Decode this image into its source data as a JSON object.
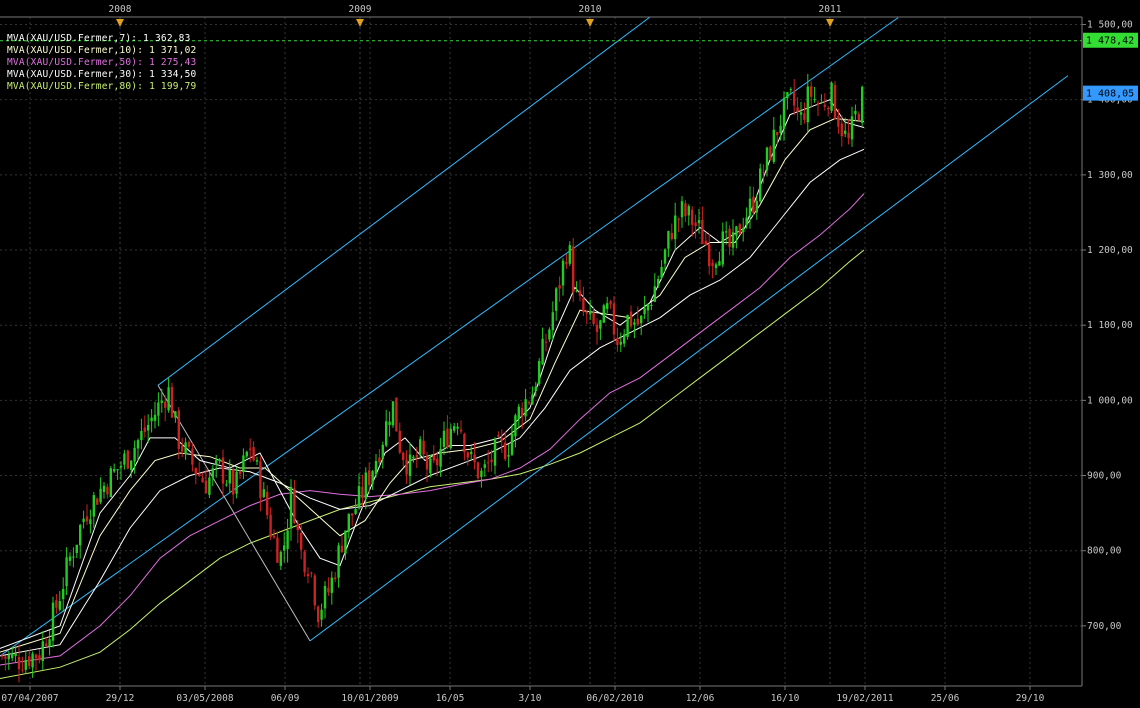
{
  "chart_data": {
    "type": "candlestick",
    "instrument": "XAU/USD",
    "ylim": [
      620,
      1510
    ],
    "y_ticks": [
      "1 500,00",
      "1 400,00",
      "1 300,00",
      "1 200,00",
      "1 100,00",
      "1 000,00",
      "900,00",
      "800,00",
      "700,00"
    ],
    "x_ticks": [
      "07/04/2007",
      "29/12",
      "03/05/2008",
      "06/09",
      "10/01/2009",
      "16/05",
      "3/10",
      "06/02/2010",
      "12/06",
      "16/10",
      "19/02/2011",
      "25/06",
      "29/10"
    ],
    "years": [
      "2008",
      "2009",
      "2010",
      "2011"
    ],
    "legend": [
      {
        "label": "MVA(XAU/USD.Fermer,7): 1 362,83",
        "color": "#ffffff"
      },
      {
        "label": "MVA(XAU/USD.Fermer,10): 1 371,02",
        "color": "#ffffd0"
      },
      {
        "label": "MVA(XAU/USD.Fermer,50): 1 275,43",
        "color": "#e070e0"
      },
      {
        "label": "MVA(XAU/USD.Fermer,30): 1 334,50",
        "color": "#ffffff"
      },
      {
        "label": "MVA(XAU/USD.Fermer,80): 1 199,79",
        "color": "#c8f070"
      }
    ],
    "reference_line": {
      "value": 1478.42,
      "label": "1 478,42",
      "color": "#33dd33"
    },
    "last_price": {
      "value": 1408.05,
      "label": "1 408,05",
      "color": "#3399ff"
    },
    "colors": {
      "up": "#22cc22",
      "down": "#cc2222",
      "channel": "#33bbff",
      "grid": "#333333"
    },
    "price_path": [
      [
        0,
        660
      ],
      [
        20,
        655
      ],
      [
        40,
        665
      ],
      [
        55,
        720
      ],
      [
        70,
        790
      ],
      [
        85,
        850
      ],
      [
        100,
        880
      ],
      [
        115,
        905
      ],
      [
        130,
        930
      ],
      [
        145,
        960
      ],
      [
        158,
        990
      ],
      [
        168,
        1015
      ],
      [
        178,
        950
      ],
      [
        190,
        920
      ],
      [
        205,
        890
      ],
      [
        220,
        910
      ],
      [
        235,
        880
      ],
      [
        250,
        940
      ],
      [
        262,
        880
      ],
      [
        272,
        820
      ],
      [
        282,
        790
      ],
      [
        292,
        880
      ],
      [
        300,
        800
      ],
      [
        310,
        780
      ],
      [
        318,
        720
      ],
      [
        330,
        750
      ],
      [
        345,
        830
      ],
      [
        360,
        870
      ],
      [
        375,
        920
      ],
      [
        385,
        960
      ],
      [
        392,
        1000
      ],
      [
        400,
        940
      ],
      [
        410,
        910
      ],
      [
        420,
        930
      ],
      [
        432,
        900
      ],
      [
        445,
        950
      ],
      [
        458,
        980
      ],
      [
        470,
        920
      ],
      [
        482,
        900
      ],
      [
        495,
        930
      ],
      [
        508,
        940
      ],
      [
        520,
        990
      ],
      [
        532,
        1010
      ],
      [
        540,
        1050
      ],
      [
        550,
        1100
      ],
      [
        560,
        1160
      ],
      [
        568,
        1210
      ],
      [
        575,
        1140
      ],
      [
        585,
        1110
      ],
      [
        598,
        1090
      ],
      [
        608,
        1120
      ],
      [
        618,
        1080
      ],
      [
        628,
        1110
      ],
      [
        640,
        1100
      ],
      [
        652,
        1140
      ],
      [
        662,
        1180
      ],
      [
        672,
        1230
      ],
      [
        682,
        1250
      ],
      [
        692,
        1240
      ],
      [
        702,
        1220
      ],
      [
        712,
        1190
      ],
      [
        722,
        1210
      ],
      [
        732,
        1200
      ],
      [
        742,
        1240
      ],
      [
        752,
        1260
      ],
      [
        762,
        1300
      ],
      [
        772,
        1340
      ],
      [
        782,
        1380
      ],
      [
        792,
        1400
      ],
      [
        800,
        1370
      ],
      [
        810,
        1410
      ],
      [
        820,
        1390
      ],
      [
        830,
        1410
      ],
      [
        840,
        1370
      ],
      [
        848,
        1340
      ],
      [
        856,
        1380
      ],
      [
        864,
        1408
      ]
    ],
    "ma7": [
      [
        0,
        670
      ],
      [
        60,
        700
      ],
      [
        100,
        850
      ],
      [
        130,
        900
      ],
      [
        150,
        950
      ],
      [
        175,
        950
      ],
      [
        200,
        920
      ],
      [
        230,
        910
      ],
      [
        260,
        930
      ],
      [
        280,
        880
      ],
      [
        300,
        830
      ],
      [
        320,
        790
      ],
      [
        340,
        780
      ],
      [
        360,
        850
      ],
      [
        385,
        930
      ],
      [
        405,
        950
      ],
      [
        425,
        920
      ],
      [
        450,
        940
      ],
      [
        470,
        940
      ],
      [
        500,
        950
      ],
      [
        530,
        990
      ],
      [
        555,
        1090
      ],
      [
        575,
        1150
      ],
      [
        595,
        1120
      ],
      [
        620,
        1100
      ],
      [
        650,
        1130
      ],
      [
        675,
        1200
      ],
      [
        700,
        1230
      ],
      [
        720,
        1210
      ],
      [
        745,
        1230
      ],
      [
        770,
        1320
      ],
      [
        790,
        1380
      ],
      [
        810,
        1390
      ],
      [
        830,
        1400
      ],
      [
        845,
        1370
      ],
      [
        864,
        1363
      ]
    ],
    "ma10": [
      [
        0,
        665
      ],
      [
        60,
        690
      ],
      [
        100,
        820
      ],
      [
        130,
        880
      ],
      [
        155,
        920
      ],
      [
        180,
        930
      ],
      [
        210,
        925
      ],
      [
        240,
        910
      ],
      [
        265,
        910
      ],
      [
        290,
        880
      ],
      [
        315,
        850
      ],
      [
        340,
        820
      ],
      [
        365,
        840
      ],
      [
        390,
        890
      ],
      [
        410,
        920
      ],
      [
        440,
        930
      ],
      [
        470,
        935
      ],
      [
        500,
        945
      ],
      [
        530,
        975
      ],
      [
        555,
        1050
      ],
      [
        580,
        1120
      ],
      [
        605,
        1115
      ],
      [
        630,
        1110
      ],
      [
        660,
        1140
      ],
      [
        685,
        1190
      ],
      [
        710,
        1210
      ],
      [
        735,
        1210
      ],
      [
        760,
        1260
      ],
      [
        785,
        1320
      ],
      [
        810,
        1360
      ],
      [
        835,
        1375
      ],
      [
        864,
        1371
      ]
    ],
    "ma30": [
      [
        0,
        660
      ],
      [
        60,
        675
      ],
      [
        100,
        760
      ],
      [
        130,
        830
      ],
      [
        160,
        880
      ],
      [
        190,
        900
      ],
      [
        220,
        910
      ],
      [
        250,
        905
      ],
      [
        280,
        890
      ],
      [
        310,
        870
      ],
      [
        340,
        855
      ],
      [
        370,
        860
      ],
      [
        400,
        880
      ],
      [
        430,
        900
      ],
      [
        460,
        915
      ],
      [
        490,
        930
      ],
      [
        520,
        950
      ],
      [
        545,
        990
      ],
      [
        570,
        1040
      ],
      [
        600,
        1070
      ],
      [
        630,
        1090
      ],
      [
        660,
        1110
      ],
      [
        690,
        1140
      ],
      [
        720,
        1160
      ],
      [
        750,
        1190
      ],
      [
        780,
        1240
      ],
      [
        810,
        1290
      ],
      [
        840,
        1320
      ],
      [
        864,
        1334
      ]
    ],
    "ma50": [
      [
        0,
        648
      ],
      [
        60,
        660
      ],
      [
        100,
        700
      ],
      [
        130,
        740
      ],
      [
        160,
        790
      ],
      [
        190,
        820
      ],
      [
        220,
        840
      ],
      [
        250,
        860
      ],
      [
        280,
        875
      ],
      [
        310,
        880
      ],
      [
        340,
        875
      ],
      [
        370,
        872
      ],
      [
        400,
        875
      ],
      [
        430,
        880
      ],
      [
        460,
        888
      ],
      [
        490,
        895
      ],
      [
        520,
        910
      ],
      [
        550,
        935
      ],
      [
        580,
        975
      ],
      [
        610,
        1010
      ],
      [
        640,
        1030
      ],
      [
        670,
        1060
      ],
      [
        700,
        1090
      ],
      [
        730,
        1120
      ],
      [
        760,
        1150
      ],
      [
        790,
        1190
      ],
      [
        820,
        1220
      ],
      [
        850,
        1255
      ],
      [
        864,
        1275
      ]
    ],
    "ma80": [
      [
        0,
        630
      ],
      [
        60,
        645
      ],
      [
        100,
        665
      ],
      [
        130,
        695
      ],
      [
        160,
        730
      ],
      [
        190,
        760
      ],
      [
        220,
        790
      ],
      [
        250,
        810
      ],
      [
        280,
        825
      ],
      [
        310,
        840
      ],
      [
        340,
        855
      ],
      [
        370,
        865
      ],
      [
        400,
        875
      ],
      [
        430,
        885
      ],
      [
        460,
        890
      ],
      [
        490,
        895
      ],
      [
        520,
        902
      ],
      [
        550,
        915
      ],
      [
        580,
        930
      ],
      [
        610,
        950
      ],
      [
        640,
        970
      ],
      [
        670,
        1000
      ],
      [
        700,
        1030
      ],
      [
        730,
        1060
      ],
      [
        760,
        1090
      ],
      [
        790,
        1120
      ],
      [
        820,
        1150
      ],
      [
        850,
        1185
      ],
      [
        864,
        1200
      ]
    ],
    "channel_lines": [
      [
        [
          158,
          1020
        ],
        [
          650,
          1510
        ]
      ],
      [
        [
          310,
          680
        ],
        [
          1068,
          1432
        ]
      ],
      [
        [
          0,
          660
        ],
        [
          898,
          1509
        ]
      ],
      [
        [
          158,
          1020
        ],
        [
          310,
          680
        ]
      ]
    ]
  }
}
